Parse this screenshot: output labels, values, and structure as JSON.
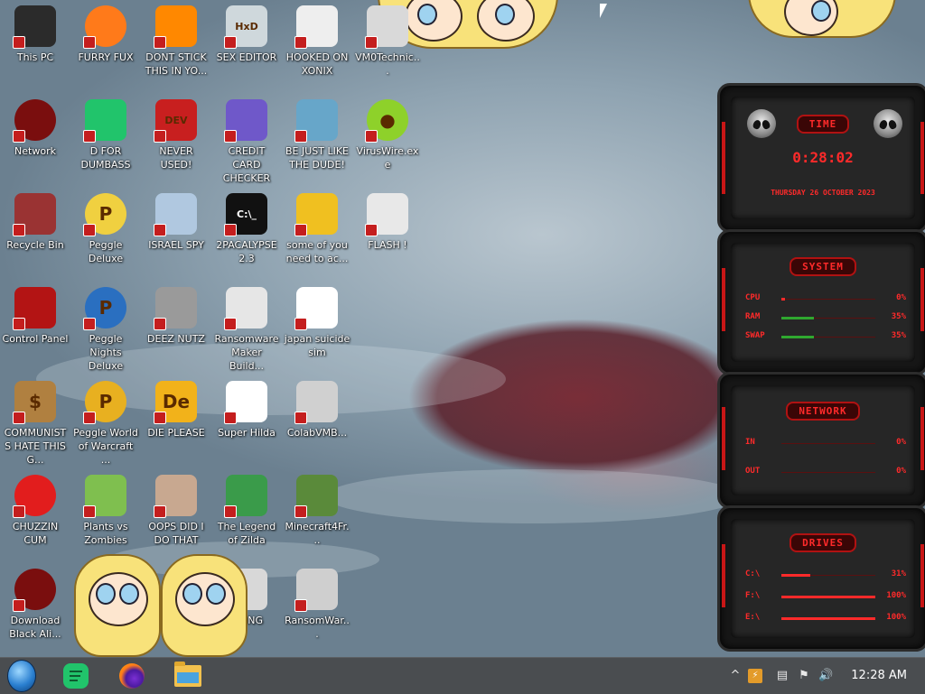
{
  "desktop": {
    "icons": [
      {
        "label": "This PC",
        "icon": "computer-icon"
      },
      {
        "label": "FURRY FUX",
        "icon": "firefox-icon"
      },
      {
        "label": "DONT STICK THIS IN YO...",
        "icon": "vlc-icon"
      },
      {
        "label": "SEX EDITOR",
        "icon": "hxd-icon"
      },
      {
        "label": "HOOKED ON XONIX",
        "icon": "xonix-icon"
      },
      {
        "label": "VM0Technic...",
        "icon": "vm-icon"
      },
      {
        "label": "Network",
        "icon": "network-icon"
      },
      {
        "label": "D FOR DUMBASS",
        "icon": "discord-icon"
      },
      {
        "label": "NEVER USED!",
        "icon": "devcpp-icon"
      },
      {
        "label": "CREDIT CARD CHECKER",
        "icon": "credit-card-icon"
      },
      {
        "label": "BE JUST LIKE THE DUDE!",
        "icon": "dude-icon"
      },
      {
        "label": "VirusWire.exe",
        "icon": "lime-icon"
      },
      {
        "label": "Recycle Bin",
        "icon": "recycle-bin-icon"
      },
      {
        "label": "Peggle Deluxe",
        "icon": "peggle-icon"
      },
      {
        "label": "ISRAEL SPY",
        "icon": "spy-icon"
      },
      {
        "label": "2PACALYPSE 2.3",
        "icon": "terminal-icon"
      },
      {
        "label": "some of you need to ac...",
        "icon": "dog-icon"
      },
      {
        "label": "FLASH !",
        "icon": "flash-icon"
      },
      {
        "label": "Control Panel",
        "icon": "control-panel-icon"
      },
      {
        "label": "Peggle Nights Deluxe",
        "icon": "peggle-nights-icon"
      },
      {
        "label": "DEEZ NUTZ",
        "icon": "stack-icon"
      },
      {
        "label": "Ransomware Maker Build...",
        "icon": "window-icon"
      },
      {
        "label": "japan suicide sim",
        "icon": "sim-icon"
      },
      {
        "label": "COMMUNISTS HATE THIS G...",
        "icon": "money-bag-icon"
      },
      {
        "label": "Peggle World of Warcraft ...",
        "icon": "peggle-wow-icon"
      },
      {
        "label": "DIE PLEASE",
        "icon": "de-icon"
      },
      {
        "label": "Super Hilda",
        "icon": "hilda-icon"
      },
      {
        "label": "ColabVMB...",
        "icon": "monitor-icon"
      },
      {
        "label": "CHUZZIN CUM",
        "icon": "chuzzle-icon"
      },
      {
        "label": "Plants vs Zombies",
        "icon": "pvz-icon"
      },
      {
        "label": "OOPS DID I DO THAT",
        "icon": "portrait-icon"
      },
      {
        "label": "The Legend of Zilda",
        "icon": "zilda-icon"
      },
      {
        "label": "Minecraft4Fr...",
        "icon": "minecraft-icon"
      },
      {
        "label": "Download Black Ali...",
        "icon": "alien-icon"
      },
      {
        "label": "CHING",
        "icon": "ching-icon"
      },
      {
        "label": "RansomWar...",
        "icon": "skull-icon"
      }
    ]
  },
  "widgets": {
    "time": {
      "title": "TIME",
      "clock": "0:28:02",
      "date": "THURSDAY 26 OCTOBER 2023"
    },
    "system": {
      "title": "SYSTEM",
      "rows": [
        {
          "key": "CPU",
          "value": "0%",
          "level": 0.04
        },
        {
          "key": "RAM",
          "value": "35%",
          "level": 0.35
        },
        {
          "key": "SWAP",
          "value": "35%",
          "level": 0.35
        }
      ]
    },
    "network": {
      "title": "NETWORK",
      "rows": [
        {
          "key": "IN",
          "value": "0%"
        },
        {
          "key": "OUT",
          "value": "0%"
        }
      ]
    },
    "drives": {
      "title": "DRIVES",
      "rows": [
        {
          "key": "C:\\",
          "value": "31%",
          "level": 0.31
        },
        {
          "key": "F:\\",
          "value": "100%",
          "level": 1.0
        },
        {
          "key": "E:\\",
          "value": "100%",
          "level": 1.0
        }
      ]
    }
  },
  "taskbar": {
    "start": "start-orb-icon",
    "pinned": [
      "discord-icon",
      "firefox-icon",
      "file-explorer-icon"
    ],
    "tray": [
      "tray-app-icon",
      "network-warning-icon",
      "action-center-icon",
      "volume-icon"
    ],
    "clock": "12:28 AM"
  },
  "colors": {
    "widget_red": "#ff2a2a",
    "widget_bg": "#262626",
    "taskbar": "#4a4d50"
  }
}
